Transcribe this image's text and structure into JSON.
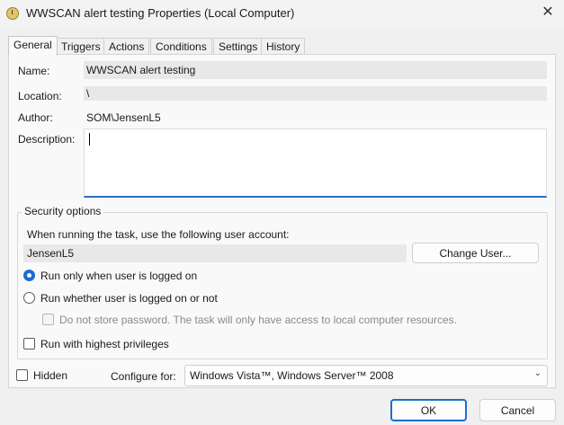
{
  "window": {
    "title": "WWSCAN alert testing Properties (Local Computer)",
    "close_glyph": "✕"
  },
  "tabs": [
    {
      "label": "General",
      "active": true
    },
    {
      "label": "Triggers"
    },
    {
      "label": "Actions"
    },
    {
      "label": "Conditions"
    },
    {
      "label": "Settings"
    },
    {
      "label": "History"
    }
  ],
  "general": {
    "name_label": "Name:",
    "name_value": "WWSCAN alert testing",
    "location_label": "Location:",
    "location_value": "\\",
    "author_label": "Author:",
    "author_value": "SOM\\JensenL5",
    "description_label": "Description:",
    "description_value": ""
  },
  "security": {
    "legend": "Security options",
    "account_prompt": "When running the task, use the following user account:",
    "account_value": "JensenL5",
    "change_user_label": "Change User...",
    "radio_logged_on": "Run only when user is logged on",
    "radio_whether": "Run whether user is logged on or not",
    "do_not_store": "Do not store password.  The task will only have access to local computer resources.",
    "highest_privileges": "Run with highest privileges"
  },
  "bottom": {
    "hidden_label": "Hidden",
    "configure_label": "Configure for:",
    "configure_value": "Windows Vista™, Windows Server™ 2008"
  },
  "footer": {
    "ok_label": "OK",
    "cancel_label": "Cancel"
  },
  "colors": {
    "accent": "#1a6ecf",
    "panel": "#f9f9f9",
    "window": "#f0f0f0"
  }
}
